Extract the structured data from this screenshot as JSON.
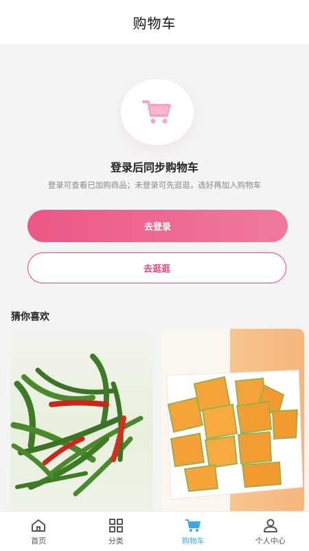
{
  "header": {
    "title": "购物车"
  },
  "empty_state": {
    "icon": "shopping-cart-icon",
    "title": "登录后同步购物车",
    "description": "登录可查看已加购商品；未登录可先逛逛，选好再加入购物车",
    "login_button": "去登录",
    "browse_button": "去逛逛"
  },
  "recommend": {
    "title": "猜你喜欢",
    "items": [
      {
        "image": "green-and-red-chili-peppers"
      },
      {
        "image": "pumpkin-chunks-on-plate"
      }
    ]
  },
  "tabbar": {
    "items": [
      {
        "label": "首页",
        "icon": "home-icon",
        "active": false
      },
      {
        "label": "分类",
        "icon": "grid-icon",
        "active": false
      },
      {
        "label": "购物车",
        "icon": "cart-icon",
        "active": true
      },
      {
        "label": "个人中心",
        "icon": "user-icon",
        "active": false
      }
    ]
  },
  "colors": {
    "accent": "#e8447a",
    "tab_active": "#3aa7e6",
    "background": "#f4f4f5"
  }
}
